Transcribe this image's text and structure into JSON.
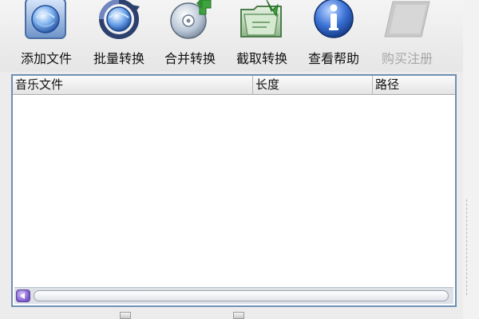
{
  "toolbar": {
    "buttons": [
      {
        "label": "添加文件",
        "icon": "add-file-icon",
        "enabled": true
      },
      {
        "label": "批量转换",
        "icon": "batch-convert-icon",
        "enabled": true
      },
      {
        "label": "合并转换",
        "icon": "merge-convert-icon",
        "enabled": true
      },
      {
        "label": "截取转换",
        "icon": "cut-convert-icon",
        "enabled": true
      },
      {
        "label": "查看帮助",
        "icon": "help-icon",
        "enabled": true
      },
      {
        "label": "购买注册",
        "icon": "register-icon",
        "enabled": false
      }
    ]
  },
  "list": {
    "columns": [
      "音乐文件",
      "长度",
      "路径"
    ],
    "rows": []
  },
  "colors": {
    "list_border": "#6f8fb4",
    "disabled_text": "#a6a6a6"
  }
}
